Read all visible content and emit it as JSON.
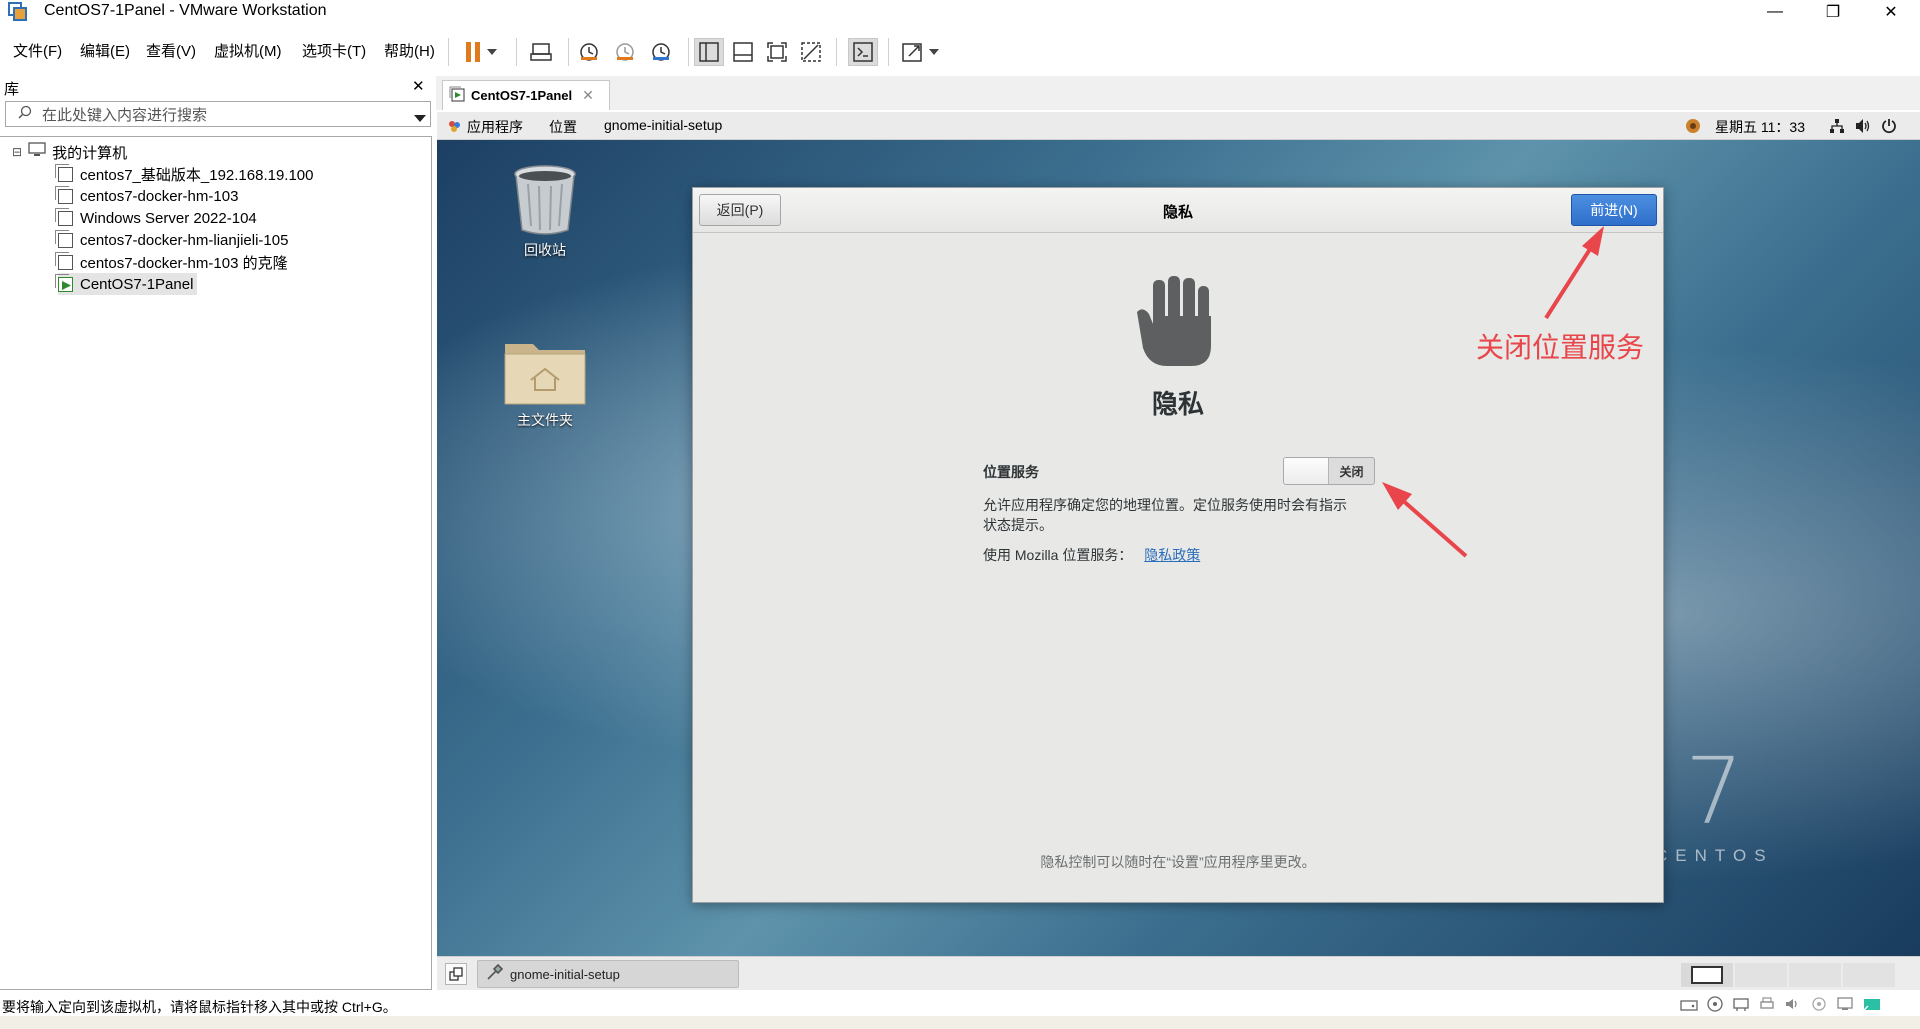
{
  "window": {
    "title": "CentOS7-1Panel - VMware Workstation",
    "minimize": "—",
    "restore": "❐",
    "close": "✕"
  },
  "menu": {
    "items": [
      "文件(F)",
      "编辑(E)",
      "查看(V)",
      "虚拟机(M)",
      "选项卡(T)",
      "帮助(H)"
    ]
  },
  "library": {
    "title": "库",
    "close": "✕",
    "search_placeholder": "在此处键入内容进行搜索",
    "root": "我的计算机",
    "items": [
      "centos7_基础版本_192.168.19.100",
      "centos7-docker-hm-103",
      "Windows Server 2022-104",
      "centos7-docker-hm-lianjieli-105",
      "centos7-docker-hm-103 的克隆",
      "CentOS7-1Panel"
    ],
    "expand": "⊟"
  },
  "vm_tab": {
    "label": "CentOS7-1Panel",
    "close": "✕"
  },
  "gnome_top": {
    "applications": "应用程序",
    "places": "位置",
    "current_app": "gnome-initial-setup",
    "clock": "星期五 11：33"
  },
  "desktop": {
    "trash_label": "回收站",
    "home_label": "主文件夹",
    "watermark_number": "7",
    "watermark_text": "CENTOS"
  },
  "dialog": {
    "back_label": "返回(P)",
    "header_title": "隐私",
    "next_label": "前进(N)",
    "page_title": "隐私",
    "location_label": "位置服务",
    "toggle_label": "关闭",
    "description_line1": "允许应用程序确定您的地理位置。定位服务使用时会有指示",
    "description_line2": "状态提示。",
    "mozilla_text": "使用 Mozilla 位置服务：",
    "privacy_link": "隐私政策",
    "footer_text": "隐私控制可以随时在“设置”应用程序里更改。"
  },
  "annotation": {
    "text": "关闭位置服务",
    "color": "#e8464a"
  },
  "taskbar": {
    "task_label": "gnome-initial-setup"
  },
  "statusbar": {
    "text": "要将输入定向到该虚拟机，请将鼠标指针移入其中或按 Ctrl+G。"
  },
  "colors": {
    "accent_blue": "#2f76cf",
    "pause_orange": "#e07a1f",
    "link_blue": "#2a6ebb"
  }
}
